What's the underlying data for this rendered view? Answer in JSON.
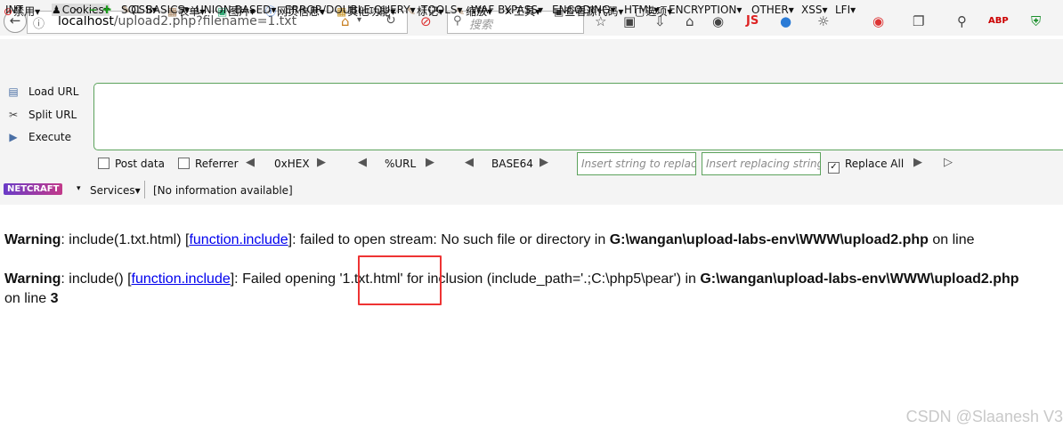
{
  "browser": {
    "url_host": "localhost",
    "url_path": "/upload2.php?filename=1.txt",
    "search_placeholder": "搜索"
  },
  "menubar": {
    "items": [
      "禁用▾",
      "Cookies▾",
      "CSS▾",
      "表单▾",
      "图片▾",
      "网页信息▾",
      "其他功能▾",
      "标记▾",
      "缩放▾",
      "工具▾",
      "查看源代码▾",
      "选项▾"
    ]
  },
  "hackbar": {
    "type_select": "INT",
    "menu": [
      "SQL BASICS▾",
      "UNION BASED▾",
      "ERROR/DOUBLE QUERY▾",
      "TOOLS▾",
      "WAF BYPASS▾",
      "ENCODING▾",
      "HTML▾",
      "ENCRYPTION▾",
      "OTHER▾",
      "XSS▾",
      "LFI▾"
    ],
    "load_url": "Load URL",
    "split_url": "Split URL",
    "execute": "Execute",
    "post_data": "Post data",
    "referrer": "Referrer",
    "hex": "0xHEX",
    "url": "%URL",
    "base64": "BASE64",
    "insert_placeholder": "Insert string to replace",
    "replacing_placeholder": "Insert replacing string",
    "replace_all": "Replace All",
    "services": "Services▾",
    "info": "[No information available]",
    "netcraft": "NETCRAFT"
  },
  "content": {
    "w1_label": "Warning",
    "w1_text1": ": include(1.txt.html) [",
    "w1_link": "function.include",
    "w1_text2": "]: failed to open stream: No such file or directory in ",
    "w1_path": "G:\\wangan\\upload-labs-env\\WWW\\upload2.php",
    "w1_text3": " on line",
    "w2_label": "Warning",
    "w2_text1": ": include() [",
    "w2_link": "function.include",
    "w2_text2": "]: Failed opening ",
    "w2_file": "'1.txt.html'",
    "w2_text3": " for inclusion (include_path='.;C:\\php5\\pear') in ",
    "w2_path": "G:\\wangan\\upload-labs-env\\WWW\\upload2.php",
    "w2_line_text": "on line ",
    "w2_line_num": "3"
  },
  "watermark": "CSDN @Slaanesh V3"
}
